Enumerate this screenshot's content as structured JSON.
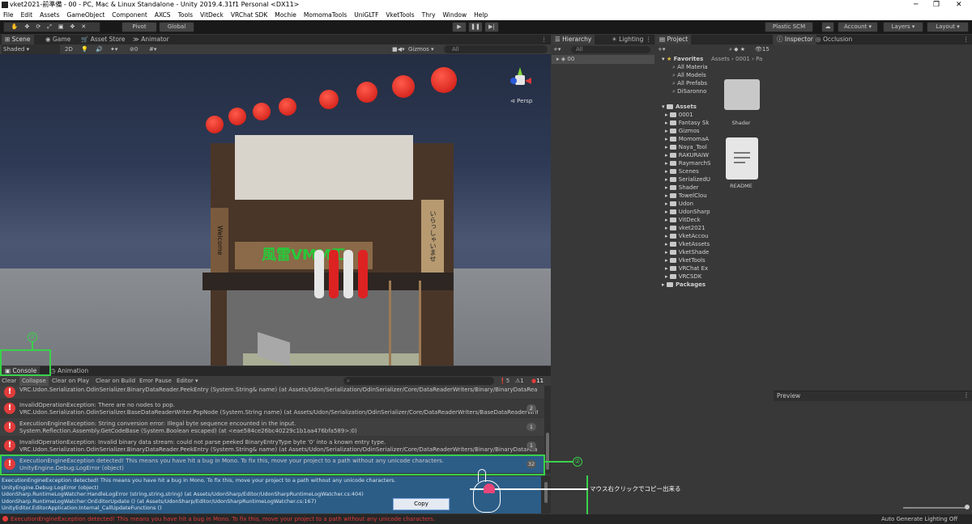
{
  "window": {
    "title": "vket2021-前準備 - 00 - PC, Mac & Linux Standalone - Unity 2019.4.31f1 Personal <DX11>"
  },
  "menu": [
    "File",
    "Edit",
    "Assets",
    "GameObject",
    "Component",
    "AXCS",
    "Tools",
    "VitDeck",
    "VRChat SDK",
    "Mochie",
    "MomomaTools",
    "UniGLTF",
    "VketTools",
    "Thry",
    "Window",
    "Help"
  ],
  "toolbar": {
    "pivot": "Pivot",
    "global": "Global",
    "plastic": "Plastic SCM",
    "account": "Account",
    "layers": "Layers",
    "layout": "Layout"
  },
  "tabs": {
    "scene": "Scene",
    "game": "Game",
    "asset_store": "Asset Store",
    "animator": "Animator",
    "hierarchy": "Hierarchy",
    "lighting": "Lighting",
    "project": "Project",
    "inspector": "Inspector",
    "occlusion": "Occlusion",
    "console": "Console",
    "animation": "Animation",
    "preview": "Preview"
  },
  "scene_toolbar": {
    "shading": "Shaded",
    "mode": "2D",
    "gizmos": "Gizmos",
    "search": "All",
    "persp": "Persp",
    "fx_count": "0"
  },
  "scene_signs": {
    "banner": "風雷VMM工",
    "left": "Welcome",
    "right": "いらっしゃいませ"
  },
  "hierarchy": {
    "search": "All",
    "root": "00"
  },
  "project": {
    "favorites_label": "Favorites",
    "favorites": [
      "All Materia",
      "All Models",
      "All Prefabs",
      "DiSaronno"
    ],
    "assets_label": "Assets",
    "folders": [
      "0001",
      "Fantasy Sk",
      "Gizmos",
      "MomomaA",
      "Naya_Tool",
      "RAKURAIW",
      "RaymarchS",
      "Scenes",
      "SerializedU",
      "Shader",
      "TowelClou",
      "Udon",
      "UdonSharp",
      "VitDeck",
      "vket2021",
      "VketAccou",
      "VketAssets",
      "VketShade",
      "VketTools",
      "VRChat Ex",
      "VRCSDK"
    ],
    "packages_label": "Packages",
    "breadcrumb": "Assets › 0001 › Pa",
    "count": "15",
    "grid": [
      {
        "name": "Shader",
        "icon": "folder-icon"
      },
      {
        "name": "README",
        "icon": "document-icon"
      }
    ]
  },
  "console": {
    "buttons": {
      "clear": "Clear",
      "collapse": "Collapse",
      "clear_on_play": "Clear on Play",
      "clear_on_build": "Clear on Build",
      "error_pause": "Error Pause",
      "editor": "Editor"
    },
    "counts": {
      "logs": "5",
      "warnings": "1",
      "errors": "11"
    },
    "rows": [
      {
        "line1": "",
        "line2": "VRC.Udon.Serialization.OdinSerializer.BinaryDataReader.PeekEntry (System.String& name) (at Assets/Udon/Serialization/OdinSerializer/Core/DataReaderWriters/Binary/BinaryDataRea...",
        "count": ""
      },
      {
        "line1": "InvalidOperationException: There are no nodes to pop.",
        "line2": "VRC.Udon.Serialization.OdinSerializer.BaseDataReaderWriter.PopNode (System.String name) (at Assets/Udon/Serialization/OdinSerializer/Core/DataReaderWriters/BaseDataReaderWrit",
        "count": "2"
      },
      {
        "line1": "ExecutionEngineException: String conversion error: Illegal byte sequence encounted in the input.",
        "line2": "System.Reflection.Assembly.GetCodeBase (System.Boolean escaped) (at <eae584ce26bc40229c1b1aa476bfa589>:0)",
        "count": "1"
      },
      {
        "line1": "InvalidOperationException: Invalid binary data stream: could not parse peeked BinaryEntryType byte '0' into a known entry type.",
        "line2": "VRC.Udon.Serialization.OdinSerializer.BinaryDataReader.PeekEntry (System.String& name) (at Assets/Udon/Serialization/OdinSerializer/Core/DataReaderWriters/Binary/BinaryDataRea",
        "count": "1"
      },
      {
        "line1": "ExecutionEngineException detected! This means you have hit a bug in Mono. To fix this, move your project to a path without any unicode characters.",
        "line2": "UnityEngine.Debug:LogError (object)",
        "count": "32"
      }
    ],
    "detail": [
      "ExecutionEngineException detected! This means you have hit a bug in Mono. To fix this, move your project to a path without any unicode characters.",
      "UnityEngine.Debug:LogError (object)",
      "UdonSharp.RuntimeLogWatcher:HandleLogError (string,string,string) (at Assets/UdonSharp/Editor/UdonSharpRuntimeLogWatcher.cs:404)",
      "UdonSharp.RuntimeLogWatcher:OnEditorUpdate () (at Assets/UdonSharp/Editor/UdonSharpRuntimeLogWatcher.cs:167)",
      "UnityEditor.EditorApplication:Internal_CallUpdateFunctions ()"
    ],
    "copy_label": "Copy"
  },
  "annotations": {
    "marker1": "①",
    "marker2": "②",
    "note": "マウス右クリックでコピー出来る"
  },
  "status": {
    "message": "ExecutionEngineException detected! This means you have hit a bug in Mono. To fix this, move your project to a path without any unicode characters.",
    "auto_lighting": "Auto Generate Lighting Off"
  },
  "colors": {
    "selection": "#2c5d87",
    "annotation_green": "#39d24a",
    "error_red": "#e23b3b"
  }
}
